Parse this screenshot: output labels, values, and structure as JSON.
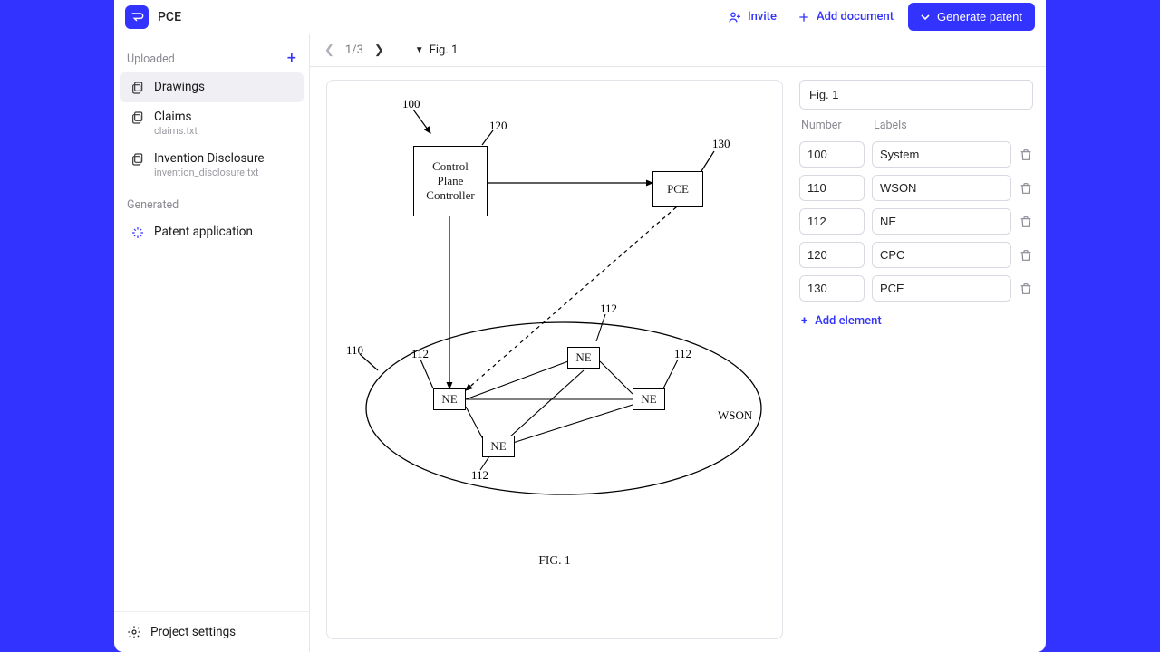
{
  "header": {
    "project_title": "PCE",
    "invite_label": "Invite",
    "add_doc_label": "Add document",
    "generate_label": "Generate patent"
  },
  "sidebar": {
    "uploaded_heading": "Uploaded",
    "items": [
      {
        "label": "Drawings",
        "sub": ""
      },
      {
        "label": "Claims",
        "sub": "claims.txt"
      },
      {
        "label": "Invention Disclosure",
        "sub": "invention_disclosure.txt"
      }
    ],
    "generated_heading": "Generated",
    "generated_items": [
      {
        "label": "Patent application"
      }
    ],
    "settings_label": "Project settings"
  },
  "toolbar": {
    "page_indicator": "1/3",
    "figure_label": "Fig. 1"
  },
  "diagram": {
    "label_100": "100",
    "label_120": "120",
    "label_130": "130",
    "label_110": "110",
    "label_112a": "112",
    "label_112b": "112",
    "label_112c": "112",
    "label_112d": "112",
    "box_cpc": "Control\nPlane\nController",
    "box_pce": "PCE",
    "ne": "NE",
    "wson": "WSON",
    "caption": "FIG. 1"
  },
  "panel": {
    "title_value": "Fig. 1",
    "col_number": "Number",
    "col_labels": "Labels",
    "rows": [
      {
        "num": "100",
        "lbl": "System"
      },
      {
        "num": "110",
        "lbl": "WSON"
      },
      {
        "num": "112",
        "lbl": "NE"
      },
      {
        "num": "120",
        "lbl": "CPC"
      },
      {
        "num": "130",
        "lbl": "PCE"
      }
    ],
    "add_label": "Add element"
  }
}
